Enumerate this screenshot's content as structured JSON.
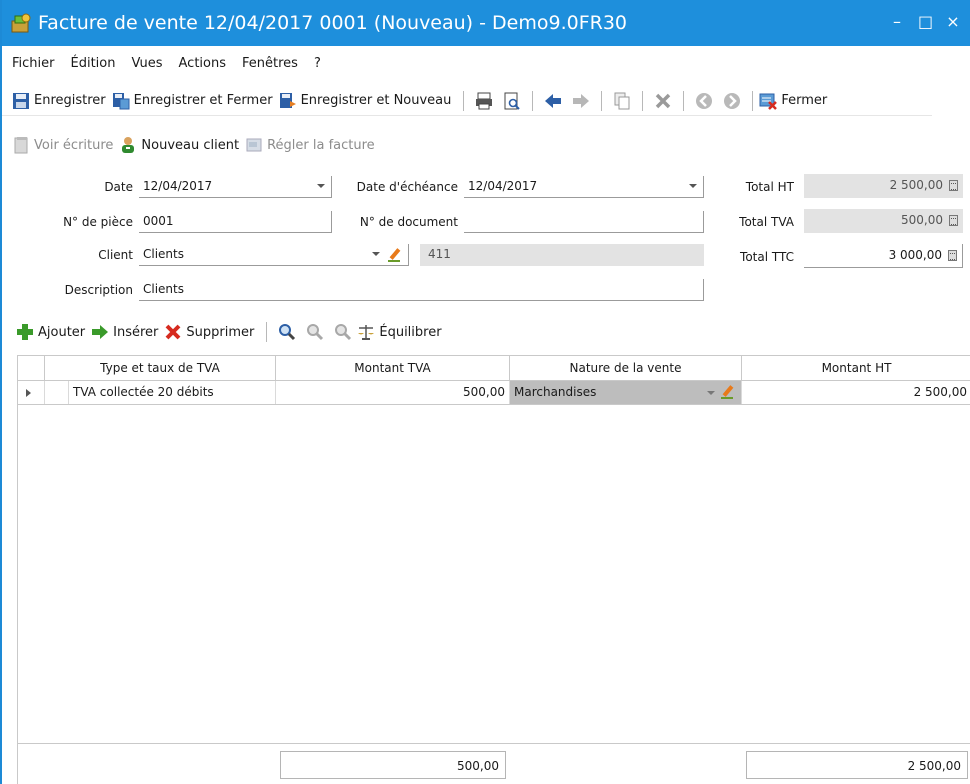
{
  "window": {
    "title": "Facture de vente 12/04/2017 0001 (Nouveau) - Demo9.0FR30",
    "minimize_glyph": "–",
    "maximize_glyph": "□",
    "close_glyph": "×",
    "accent_color": "#1e8fdc"
  },
  "menu": [
    "Fichier",
    "Édition",
    "Vues",
    "Actions",
    "Fenêtres",
    "?"
  ],
  "toolbar_main": {
    "save": "Enregistrer",
    "save_close": "Enregistrer et Fermer",
    "save_new": "Enregistrer et Nouveau",
    "close": "Fermer",
    "icons": [
      "print-icon",
      "print-preview-icon",
      "back-arrow-icon",
      "forward-arrow-icon",
      "copy-icon",
      "delete-icon",
      "previous-record-icon",
      "next-record-icon",
      "close-form-icon"
    ]
  },
  "toolbar_secondary": {
    "view_entry": "Voir écriture",
    "new_client": "Nouveau client",
    "pay_invoice": "Régler la facture"
  },
  "form": {
    "date_label": "Date",
    "date_value": "12/04/2017",
    "due_date_label": "Date d'échéance",
    "due_date_value": "12/04/2017",
    "piece_label": "N° de pièce",
    "piece_value": "0001",
    "document_label": "N° de document",
    "document_value": "",
    "client_label": "Client",
    "client_value": "Clients",
    "client_account": "411",
    "description_label": "Description",
    "description_value": "Clients"
  },
  "totals": {
    "ht_label": "Total HT",
    "ht_value": "2 500,00",
    "tva_label": "Total TVA",
    "tva_value": "500,00",
    "ttc_label": "Total TTC",
    "ttc_value": "3 000,00"
  },
  "grid_toolbar": {
    "add": "Ajouter",
    "insert": "Insérer",
    "delete": "Supprimer",
    "balance": "Équilibrer"
  },
  "grid": {
    "columns": [
      "Type et taux de TVA",
      "Montant TVA",
      "Nature de la vente",
      "Montant HT"
    ],
    "rows": [
      [
        "TVA collectée 20 débits",
        "500,00",
        "Marchandises",
        "2 500,00"
      ]
    ],
    "footer": {
      "montant_tva_total": "500,00",
      "montant_ht_total": "2 500,00"
    }
  }
}
